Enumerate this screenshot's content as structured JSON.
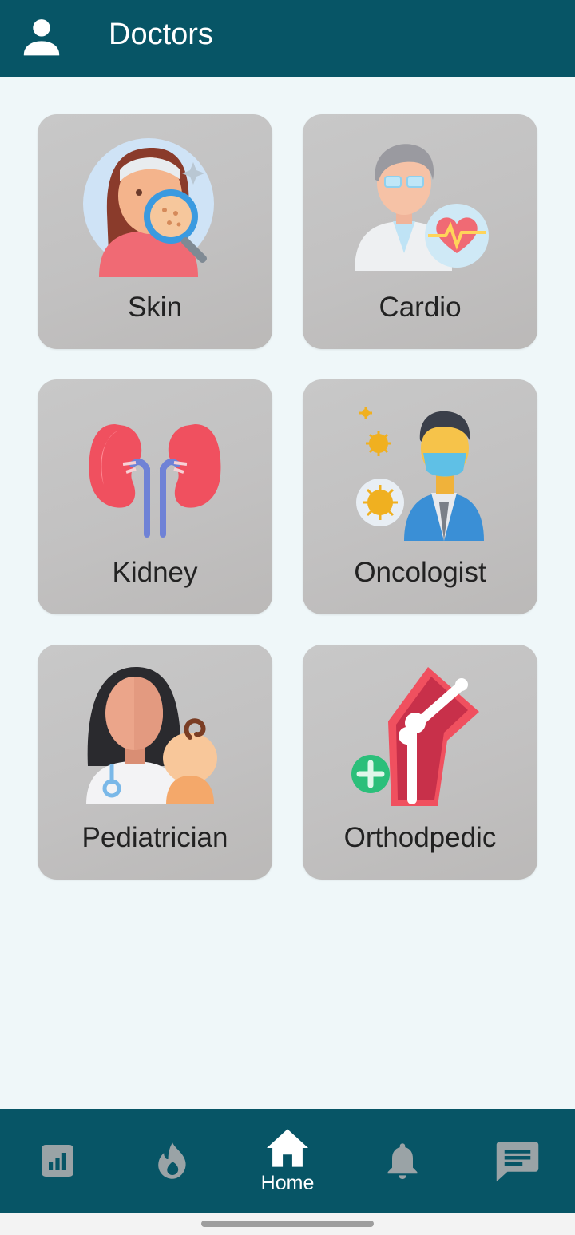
{
  "appbar": {
    "title": "Doctors",
    "profile_icon": "person-icon",
    "background": "#075566"
  },
  "categories": [
    {
      "label": "Skin",
      "icon": "dermatologist-icon"
    },
    {
      "label": "Cardio",
      "icon": "cardiologist-icon"
    },
    {
      "label": "Kidney",
      "icon": "kidney-icon"
    },
    {
      "label": "Oncologist",
      "icon": "oncologist-icon"
    },
    {
      "label": "Pediatrician",
      "icon": "pediatrician-icon"
    },
    {
      "label": "Orthodpedic",
      "icon": "orthopedic-bone-icon"
    }
  ],
  "bottom_nav": {
    "items": [
      {
        "icon": "stats-icon",
        "label": ""
      },
      {
        "icon": "fire-icon",
        "label": ""
      },
      {
        "icon": "home-icon",
        "label": "Home",
        "active": true
      },
      {
        "icon": "bell-icon",
        "label": ""
      },
      {
        "icon": "chat-icon",
        "label": ""
      }
    ],
    "active_color": "#ffffff",
    "inactive_color": "#9aa3a6"
  }
}
